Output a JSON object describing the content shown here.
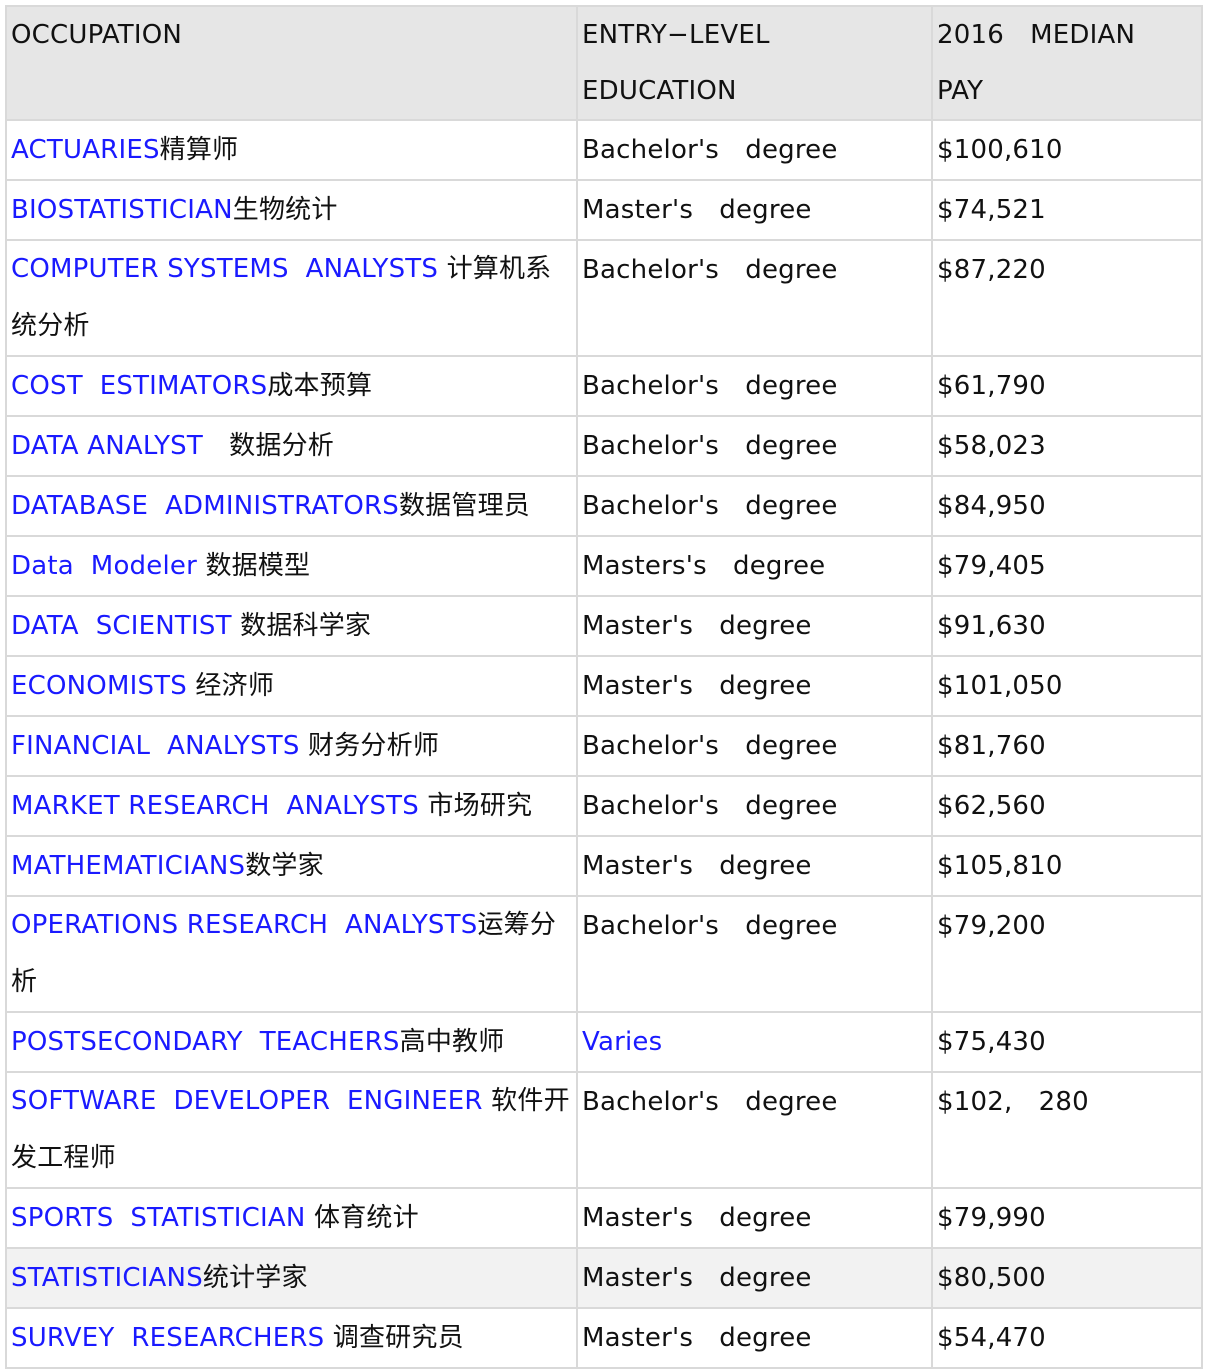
{
  "header": {
    "occupation": "OCCUPATION",
    "education_line1": "ENTRY−LEVEL",
    "education_line2": "EDUCATION",
    "pay_line1": "2016　MEDIAN",
    "pay_line2": "PAY"
  },
  "colors": {
    "link": "#1a1aff",
    "header_bg": "#e6e6e6",
    "border": "#d9d9d9"
  },
  "rows": [
    {
      "en": "ACTUARIES",
      "zh": "精算师",
      "education": "Bachelor's　degree",
      "education_link": false,
      "pay": "$100,610",
      "tall": false,
      "shaded": false
    },
    {
      "en": "BIOSTATISTICIAN",
      "zh": "生物统计",
      "education": "Master's　degree",
      "education_link": false,
      "pay": "$74,521",
      "tall": false,
      "shaded": false
    },
    {
      "en": "COMPUTER SYSTEMS  ANALYSTS ",
      "zh": "计算机系统分析",
      "education": "Bachelor's　degree",
      "education_link": false,
      "pay": "$87,220",
      "tall": true,
      "shaded": false
    },
    {
      "en": "COST  ESTIMATORS",
      "zh": "成本预算",
      "education": "Bachelor's　degree",
      "education_link": false,
      "pay": "$61,790",
      "tall": false,
      "shaded": false
    },
    {
      "en": "DATA ANALYST",
      "zh": "　数据分析",
      "education": "Bachelor's　degree",
      "education_link": false,
      "pay": "$58,023",
      "tall": false,
      "shaded": false
    },
    {
      "en": "DATABASE  ADMINISTRATORS",
      "zh": "数据管理员",
      "education": "Bachelor's　degree",
      "education_link": false,
      "pay": "$84,950",
      "tall": false,
      "shaded": false
    },
    {
      "en": "Data  Modeler ",
      "zh": "数据模型",
      "education": "Masters's　degree",
      "education_link": false,
      "pay": "$79,405",
      "tall": false,
      "shaded": false
    },
    {
      "en": "DATA  SCIENTIST ",
      "zh": "数据科学家",
      "education": "Master's　degree",
      "education_link": false,
      "pay": "$91,630",
      "tall": false,
      "shaded": false
    },
    {
      "en": "ECONOMISTS ",
      "zh": "经济师",
      "education": "Master's　degree",
      "education_link": false,
      "pay": "$101,050",
      "tall": false,
      "shaded": false
    },
    {
      "en": "FINANCIAL  ANALYSTS ",
      "zh": "财务分析师",
      "education": "Bachelor's　degree",
      "education_link": false,
      "pay": "$81,760",
      "tall": false,
      "shaded": false
    },
    {
      "en": "MARKET RESEARCH  ANALYSTS ",
      "zh": "市场研究",
      "education": "Bachelor's　degree",
      "education_link": false,
      "pay": "$62,560",
      "tall": false,
      "shaded": false
    },
    {
      "en": "MATHEMATICIANS",
      "zh": "数学家",
      "education": "Master's　degree",
      "education_link": false,
      "pay": "$105,810",
      "tall": false,
      "shaded": false
    },
    {
      "en": "OPERATIONS RESEARCH  ANALYSTS",
      "zh": "运筹分析",
      "education": "Bachelor's　degree",
      "education_link": false,
      "pay": "$79,200",
      "tall": true,
      "shaded": false
    },
    {
      "en": "POSTSECONDARY  TEACHERS",
      "zh": "高中教师",
      "education": "Varies",
      "education_link": true,
      "pay": "$75,430",
      "tall": false,
      "shaded": false
    },
    {
      "en": "SOFTWARE  DEVELOPER  ENGINEER ",
      "zh": "软件开发工程师",
      "education": "Bachelor's　degree",
      "education_link": false,
      "pay": "$102,　280",
      "tall": true,
      "shaded": false
    },
    {
      "en": "SPORTS  STATISTICIAN ",
      "zh": "体育统计",
      "education": "Master's　degree",
      "education_link": false,
      "pay": "$79,990",
      "tall": false,
      "shaded": false
    },
    {
      "en": "STATISTICIANS",
      "zh": "统计学家",
      "education": "Master's　degree",
      "education_link": false,
      "pay": "$80,500",
      "tall": false,
      "shaded": true
    },
    {
      "en": "SURVEY  RESEARCHERS ",
      "zh": "调查研究员",
      "education": "Master's　degree",
      "education_link": false,
      "pay": "$54,470",
      "tall": false,
      "shaded": false
    }
  ]
}
